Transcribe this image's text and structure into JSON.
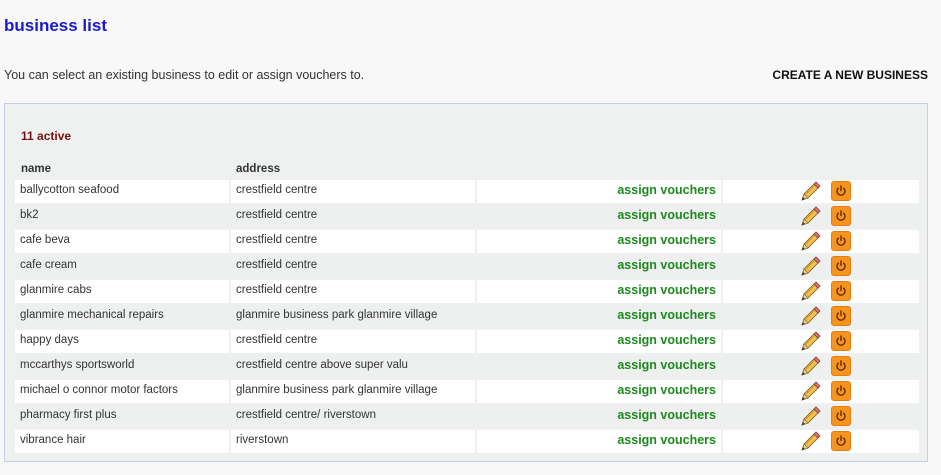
{
  "page": {
    "title": "business list",
    "intro": "You can select an existing business to edit or assign vouchers to.",
    "create_label": "CREATE A NEW BUSINESS"
  },
  "panel": {
    "active_count": "11 active",
    "columns": {
      "name": "name",
      "address": "address"
    },
    "assign_label": "assign vouchers",
    "businesses": [
      {
        "name": "ballycotton seafood",
        "address": "crestfield centre"
      },
      {
        "name": "bk2",
        "address": "crestfield centre"
      },
      {
        "name": "cafe beva",
        "address": "crestfield centre"
      },
      {
        "name": "cafe cream",
        "address": "crestfield centre"
      },
      {
        "name": "glanmire cabs",
        "address": "crestfield centre"
      },
      {
        "name": "glanmire mechanical repairs",
        "address": "glanmire business park glanmire village"
      },
      {
        "name": "happy days",
        "address": "crestfield centre"
      },
      {
        "name": "mccarthys sportsworld",
        "address": "crestfield centre above super valu"
      },
      {
        "name": "michael o connor motor factors",
        "address": "glanmire business park glanmire village"
      },
      {
        "name": "pharmacy first plus",
        "address": "crestfield centre/ riverstown"
      },
      {
        "name": "vibrance hair",
        "address": "riverstown"
      }
    ]
  },
  "icons": {
    "edit": "pencil-icon",
    "toggle": "power-icon"
  },
  "colors": {
    "title": "#1a1acd",
    "active": "#7a0f0f",
    "assign": "#1d8a1d",
    "power": "#f7941d"
  }
}
